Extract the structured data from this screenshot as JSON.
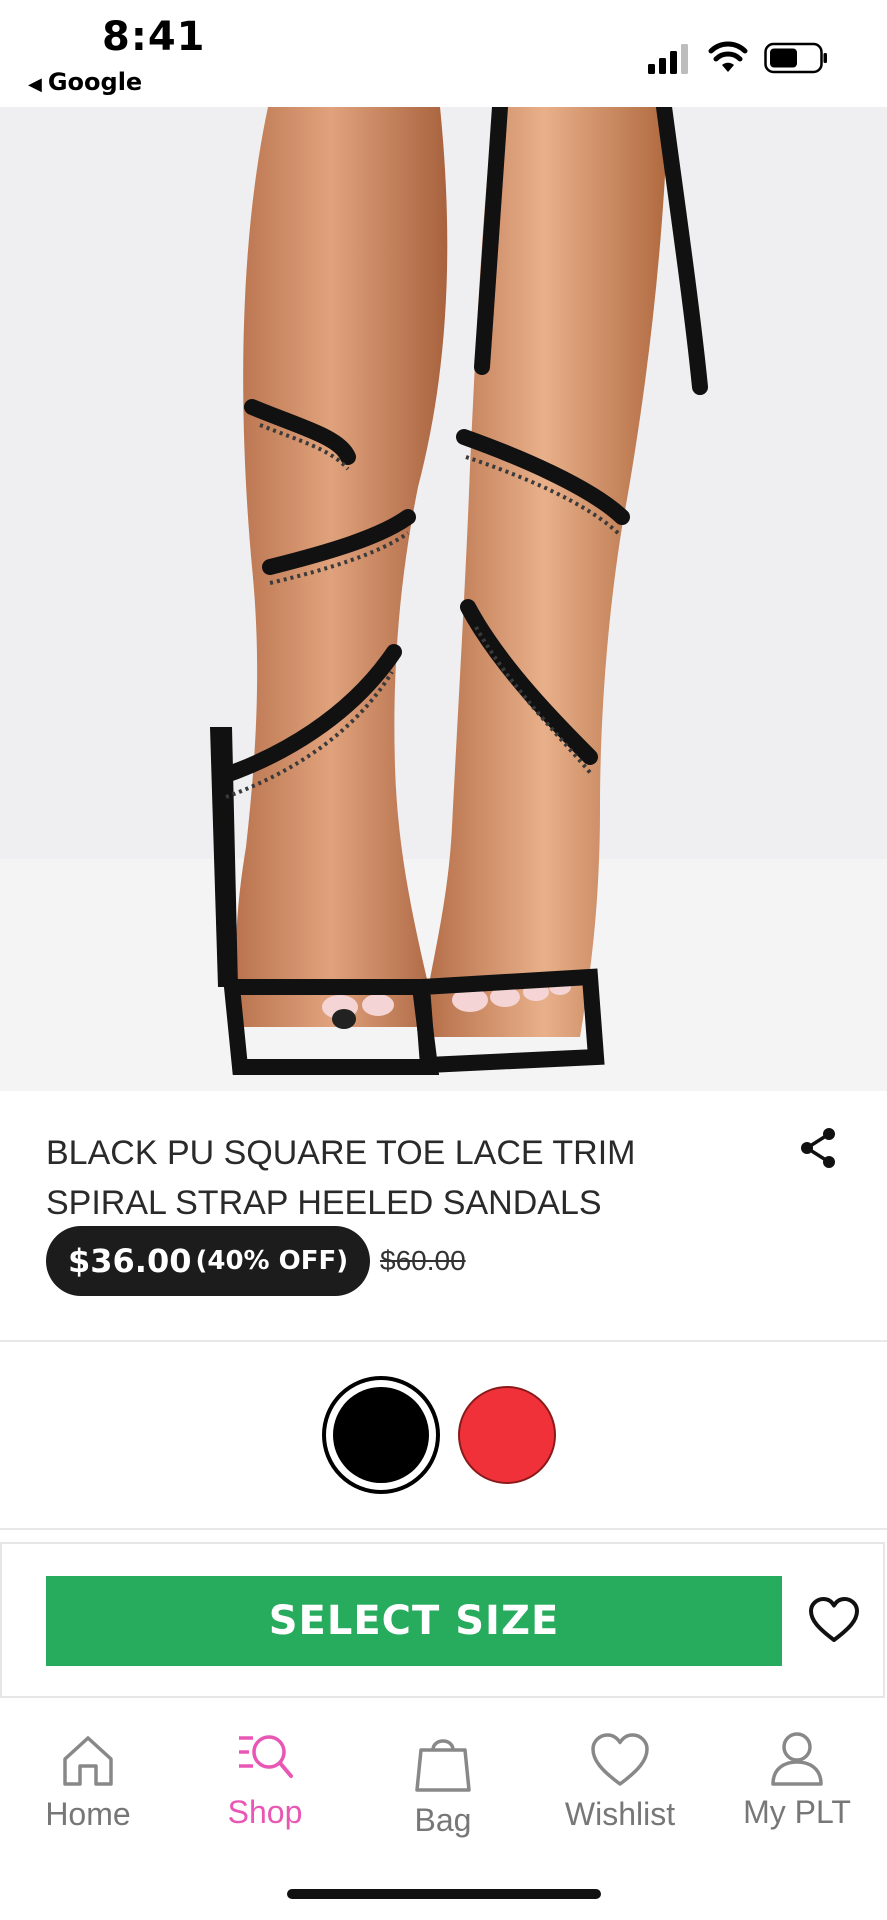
{
  "status_bar": {
    "time": "8:41",
    "back_label": "Google",
    "icons": [
      "cellular-signal-icon",
      "wifi-icon",
      "battery-icon"
    ]
  },
  "product": {
    "image_alt": "Black PU square toe lace trim spiral strap heeled sandals worn on legs",
    "title": "BLACK PU SQUARE TOE LACE TRIM SPIRAL STRAP HEELED SANDALS",
    "price_current": "$36.00",
    "price_discount": "(40% OFF)",
    "price_original": "$60.00",
    "colors": [
      {
        "name": "black",
        "hex": "#000000",
        "selected": true
      },
      {
        "name": "red",
        "hex": "#f1313a",
        "selected": false
      }
    ]
  },
  "actions": {
    "select_size_label": "SELECT SIZE",
    "select_size_color": "#27ab5c"
  },
  "tab_bar": {
    "tabs": [
      {
        "label": "Home",
        "icon": "home-icon",
        "active": false
      },
      {
        "label": "Shop",
        "icon": "shop-search-icon",
        "active": true
      },
      {
        "label": "Bag",
        "icon": "bag-icon",
        "active": false
      },
      {
        "label": "Wishlist",
        "icon": "heart-icon",
        "active": false
      },
      {
        "label": "My PLT",
        "icon": "user-icon",
        "active": false
      }
    ],
    "active_color": "#e857b4"
  }
}
